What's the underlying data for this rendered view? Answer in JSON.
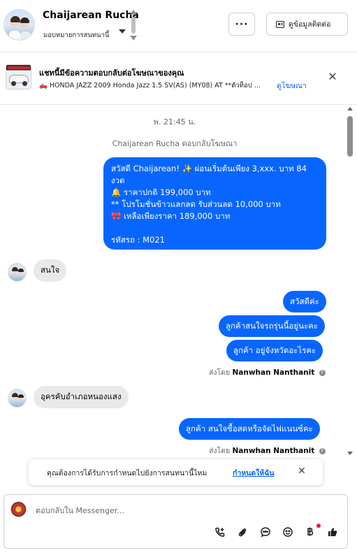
{
  "header": {
    "contact_name": "Chaijarean Rucha",
    "assign_label": "มอบหมายการสนทนานี้",
    "more_label": "···",
    "contact_info_label": "ดูข้อมูลติดต่อ"
  },
  "ad": {
    "title": "แชทนี้มีข้อความตอบกลับต่อโฆษณาของคุณ",
    "description": "🛻 HONDA JAZZ 2009 Honda Jazz 1.5 SV(AS) (MY08) AT **ตัวท็อป ...",
    "link_label": "ดูโฆษณา",
    "close_label": "✕"
  },
  "chat": {
    "timestamp": "พ. 21:45 น.",
    "ad_reply_note": "Chaijarean Rucha ตอบกลับโฆษณา",
    "ad_message_lines": [
      "สวัสดี Chaijarean! ✨  ผ่อนเริ่มต้นเพียง 3,xxx. บาท 84",
      "งวด",
      "🔔 ราคาปกติ 199,000 บาท",
      "** โปรโมชั่นข้าวแลกลด รับส่วนลด 10,000 บาท",
      "🎀  เหลือเพียงราคา 189,000 บาท",
      "",
      "รหัสรถ : M021"
    ],
    "in_msg_1": "สนใจ",
    "out_msg_1": "สวัสดีค่ะ",
    "out_msg_2": "ลูกค้าสนใจรถรุ่นนี้อยู่นะคะ",
    "out_msg_3": "ลูกค้า อยู่จังหวัดอะไรคะ",
    "sent_by_prefix": "ส่งโดย",
    "sent_by_name": "Nanwhan Nanthanit",
    "in_msg_2": "อุครคับอำเภอหนองแสง",
    "out_msg_4": "ลูกค้า สนใจซื้อสดหรือจัดไฟแนนซ์คะ",
    "sent_by_name_2": "Nanwhan Nanthanit"
  },
  "notification": {
    "text": "คุณต้องการได้รับการกำหนดไปยังการสนทนานี้ไหม",
    "link": "กำหนดให้ฉัน",
    "close_label": "✕"
  },
  "composer": {
    "placeholder": "ตอบกลับใน Messenger..."
  },
  "icons": {
    "call": "phone-plus-icon",
    "attach": "paperclip-icon",
    "saved_replies": "chat-bubble-icon",
    "emoji": "smiley-icon",
    "payment": "baht-icon",
    "like": "thumbs-up-icon"
  },
  "colors": {
    "outgoing_bubble": "#0866ff",
    "incoming_bubble": "#e9e9ea",
    "link": "#0866ff",
    "badge_red": "#e41e3f"
  }
}
